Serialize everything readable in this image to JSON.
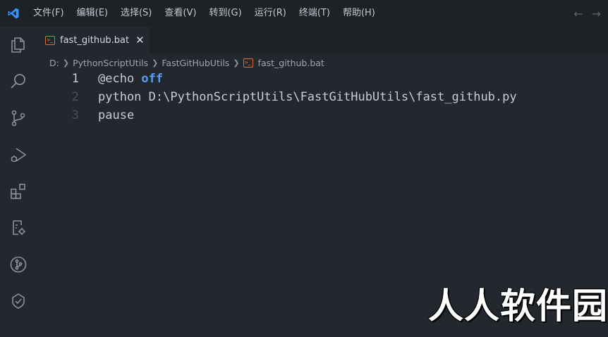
{
  "menu": [
    "文件(F)",
    "编辑(E)",
    "选择(S)",
    "查看(V)",
    "转到(G)",
    "运行(R)",
    "终端(T)",
    "帮助(H)"
  ],
  "nav": {
    "back": "←",
    "forward": "→"
  },
  "activity_icons": [
    "explorer-icon",
    "search-icon",
    "source-control-icon",
    "run-debug-icon",
    "extensions-icon",
    "remote-explorer-icon",
    "git-graph-icon",
    "testing-icon"
  ],
  "tab": {
    "label": "fast_github.bat",
    "close": "✕",
    "icon": "bat-file-icon",
    "icon_color": "#e16d3d"
  },
  "breadcrumb": {
    "drive": "D:",
    "folder1": "PythonScriptUtils",
    "folder2": "FastGitHubUtils",
    "file": "fast_github.bat"
  },
  "editor": {
    "lines": [
      {
        "number": "1",
        "prefix": "@echo ",
        "keyword": "off"
      },
      {
        "number": "2",
        "text": "python D:\\PythonScriptUtils\\FastGitHubUtils\\fast_github.py"
      },
      {
        "number": "3",
        "text": "pause"
      }
    ]
  },
  "watermark": "人人软件园",
  "colors": {
    "keyword": "#5c9bf5",
    "accent": "#3794ff",
    "background": "#23272e"
  }
}
